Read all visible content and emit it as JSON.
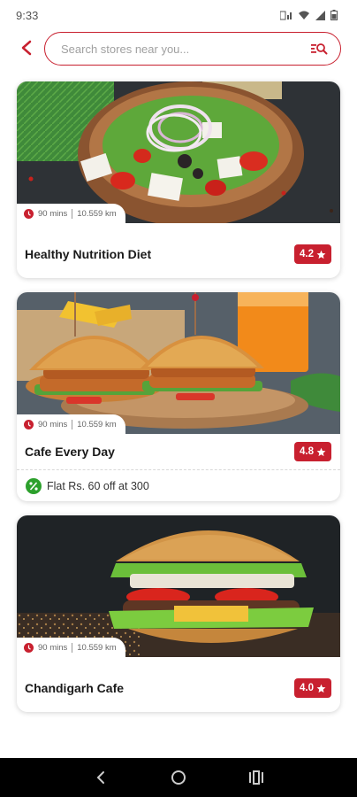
{
  "status_bar": {
    "time": "9:33"
  },
  "search": {
    "placeholder": "Search stores near you..."
  },
  "colors": {
    "accent": "#c8202f",
    "offer": "#2ca02c"
  },
  "stores": [
    {
      "title": "Healthy Nutrition Diet",
      "time": "90 mins",
      "distance": "10.559 km",
      "rating": "4.2",
      "offer": ""
    },
    {
      "title": "Cafe Every Day",
      "time": "90 mins",
      "distance": "10.559 km",
      "rating": "4.8",
      "offer": "Flat Rs. 60 off at 300"
    },
    {
      "title": "Chandigarh Cafe",
      "time": "90 mins",
      "distance": "10.559 km",
      "rating": "4.0",
      "offer": ""
    }
  ],
  "icons": {
    "back": "arrow-left-icon",
    "search": "search-list-icon",
    "clock": "clock-icon",
    "star": "star-icon",
    "offer": "percent-badge-icon"
  }
}
